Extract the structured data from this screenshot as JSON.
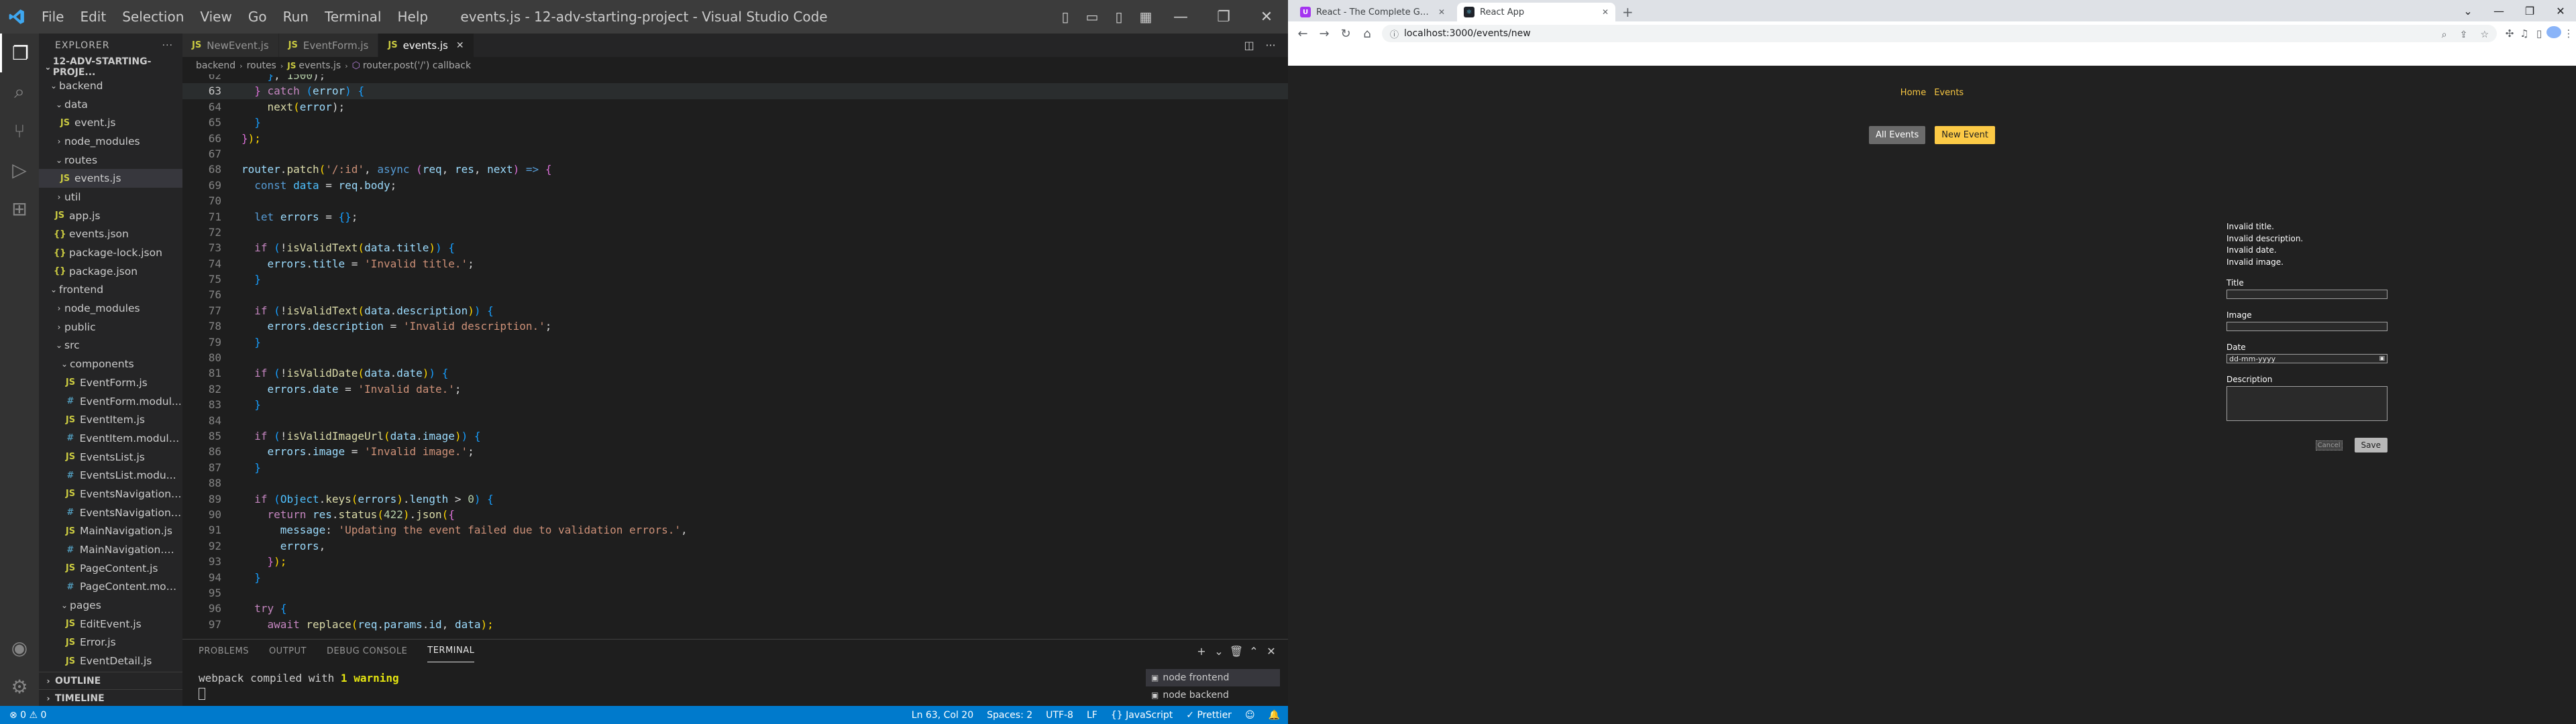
{
  "vscode": {
    "window_title": "events.js - 12-adv-starting-project - Visual Studio Code",
    "menu": [
      "File",
      "Edit",
      "Selection",
      "View",
      "Go",
      "Run",
      "Terminal",
      "Help"
    ],
    "explorer": {
      "header": "EXPLORER",
      "project": "12-ADV-STARTING-PROJE...",
      "tree": [
        {
          "label": "backend",
          "type": "folder",
          "depth": 1,
          "open": true
        },
        {
          "label": "data",
          "type": "folder",
          "depth": 2,
          "open": true
        },
        {
          "label": "event.js",
          "type": "js",
          "depth": 3
        },
        {
          "label": "node_modules",
          "type": "folder",
          "depth": 2,
          "open": false
        },
        {
          "label": "routes",
          "type": "folder",
          "depth": 2,
          "open": true
        },
        {
          "label": "events.js",
          "type": "js",
          "depth": 3,
          "selected": true
        },
        {
          "label": "util",
          "type": "folder",
          "depth": 2,
          "open": false
        },
        {
          "label": "app.js",
          "type": "js",
          "depth": 2
        },
        {
          "label": "events.json",
          "type": "json",
          "depth": 2
        },
        {
          "label": "package-lock.json",
          "type": "json",
          "depth": 2
        },
        {
          "label": "package.json",
          "type": "json",
          "depth": 2
        },
        {
          "label": "frontend",
          "type": "folder",
          "depth": 1,
          "open": true
        },
        {
          "label": "node_modules",
          "type": "folder",
          "depth": 2,
          "open": false
        },
        {
          "label": "public",
          "type": "folder",
          "depth": 2,
          "open": false
        },
        {
          "label": "src",
          "type": "folder",
          "depth": 2,
          "open": true
        },
        {
          "label": "components",
          "type": "folder",
          "depth": 3,
          "open": true
        },
        {
          "label": "EventForm.js",
          "type": "js",
          "depth": 4
        },
        {
          "label": "EventForm.modul...",
          "type": "css",
          "depth": 4
        },
        {
          "label": "EventItem.js",
          "type": "js",
          "depth": 4
        },
        {
          "label": "EventItem.module...",
          "type": "css",
          "depth": 4
        },
        {
          "label": "EventsList.js",
          "type": "js",
          "depth": 4
        },
        {
          "label": "EventsList.modu...",
          "type": "css",
          "depth": 4
        },
        {
          "label": "EventsNavigation.js",
          "type": "js",
          "depth": 4
        },
        {
          "label": "EventsNavigation....",
          "type": "css",
          "depth": 4
        },
        {
          "label": "MainNavigation.js",
          "type": "js",
          "depth": 4
        },
        {
          "label": "MainNavigation.m...",
          "type": "css",
          "depth": 4
        },
        {
          "label": "PageContent.js",
          "type": "js",
          "depth": 4
        },
        {
          "label": "PageContent.mod...",
          "type": "css",
          "depth": 4
        },
        {
          "label": "pages",
          "type": "folder",
          "depth": 3,
          "open": true
        },
        {
          "label": "EditEvent.js",
          "type": "js",
          "depth": 4
        },
        {
          "label": "Error.js",
          "type": "js",
          "depth": 4
        },
        {
          "label": "EventDetail.js",
          "type": "js",
          "depth": 4
        }
      ],
      "outline": "OUTLINE",
      "timeline": "TIMELINE"
    },
    "tabs": [
      {
        "label": "NewEvent.js",
        "active": false
      },
      {
        "label": "EventForm.js",
        "active": false
      },
      {
        "label": "events.js",
        "active": true
      }
    ],
    "breadcrumb": [
      "backend",
      "routes",
      "events.js",
      "router.post('/') callback"
    ],
    "code": {
      "first_line": 62,
      "cursor_line": 63,
      "lines": [
        [
          [
            "    ",
            ""
          ],
          [
            "}",
            "p3"
          ],
          [
            ", ",
            "op"
          ],
          [
            "1500",
            "num"
          ],
          [
            ");",
            "op"
          ]
        ],
        [
          [
            "  ",
            ""
          ],
          [
            "} ",
            "p2"
          ],
          [
            "catch",
            "kw"
          ],
          [
            " ",
            ""
          ],
          [
            "(",
            "p3"
          ],
          [
            "error",
            "var"
          ],
          [
            ")",
            "p3"
          ],
          [
            " ",
            ""
          ],
          [
            "{",
            "p3"
          ]
        ],
        [
          [
            "    ",
            ""
          ],
          [
            "next",
            "fn"
          ],
          [
            "(",
            "p1"
          ],
          [
            "error",
            "var"
          ],
          [
            ");",
            "op"
          ]
        ],
        [
          [
            "  ",
            ""
          ],
          [
            "}",
            "p3"
          ]
        ],
        [
          [
            "}",
            "p2"
          ],
          [
            ");",
            "p1"
          ]
        ],
        [
          [
            "",
            ""
          ]
        ],
        [
          [
            "router",
            "var"
          ],
          [
            ".",
            "op"
          ],
          [
            "patch",
            "fn"
          ],
          [
            "(",
            "p1"
          ],
          [
            "'/:id'",
            "str"
          ],
          [
            ", ",
            "op"
          ],
          [
            "async",
            "dk"
          ],
          [
            " ",
            ""
          ],
          [
            "(",
            "p2"
          ],
          [
            "req",
            "var"
          ],
          [
            ", ",
            "op"
          ],
          [
            "res",
            "var"
          ],
          [
            ", ",
            "op"
          ],
          [
            "next",
            "var"
          ],
          [
            ")",
            "p2"
          ],
          [
            " ",
            ""
          ],
          [
            "=>",
            "dk"
          ],
          [
            " ",
            ""
          ],
          [
            "{",
            "p2"
          ]
        ],
        [
          [
            "  ",
            ""
          ],
          [
            "const",
            "dk"
          ],
          [
            " ",
            ""
          ],
          [
            "data",
            "const"
          ],
          [
            " = ",
            "op"
          ],
          [
            "req",
            "var"
          ],
          [
            ".",
            "op"
          ],
          [
            "body",
            "var"
          ],
          [
            ";",
            "op"
          ]
        ],
        [
          [
            "",
            ""
          ]
        ],
        [
          [
            "  ",
            ""
          ],
          [
            "let",
            "dk"
          ],
          [
            " ",
            ""
          ],
          [
            "errors",
            "var"
          ],
          [
            " = ",
            "op"
          ],
          [
            "{}",
            "p3"
          ],
          [
            ";",
            "op"
          ]
        ],
        [
          [
            "",
            ""
          ]
        ],
        [
          [
            "  ",
            ""
          ],
          [
            "if",
            "kw"
          ],
          [
            " ",
            ""
          ],
          [
            "(",
            "p3"
          ],
          [
            "!",
            "op"
          ],
          [
            "isValidText",
            "fn"
          ],
          [
            "(",
            "p1"
          ],
          [
            "data",
            "var"
          ],
          [
            ".",
            "op"
          ],
          [
            "title",
            "var"
          ],
          [
            ")",
            "p1"
          ],
          [
            ")",
            "p3"
          ],
          [
            " ",
            ""
          ],
          [
            "{",
            "p3"
          ]
        ],
        [
          [
            "    ",
            ""
          ],
          [
            "errors",
            "var"
          ],
          [
            ".",
            "op"
          ],
          [
            "title",
            "var"
          ],
          [
            " = ",
            "op"
          ],
          [
            "'Invalid title.'",
            "str"
          ],
          [
            ";",
            "op"
          ]
        ],
        [
          [
            "  ",
            ""
          ],
          [
            "}",
            "p3"
          ]
        ],
        [
          [
            "",
            ""
          ]
        ],
        [
          [
            "  ",
            ""
          ],
          [
            "if",
            "kw"
          ],
          [
            " ",
            ""
          ],
          [
            "(",
            "p3"
          ],
          [
            "!",
            "op"
          ],
          [
            "isValidText",
            "fn"
          ],
          [
            "(",
            "p1"
          ],
          [
            "data",
            "var"
          ],
          [
            ".",
            "op"
          ],
          [
            "description",
            "var"
          ],
          [
            ")",
            "p1"
          ],
          [
            ")",
            "p3"
          ],
          [
            " ",
            ""
          ],
          [
            "{",
            "p3"
          ]
        ],
        [
          [
            "    ",
            ""
          ],
          [
            "errors",
            "var"
          ],
          [
            ".",
            "op"
          ],
          [
            "description",
            "var"
          ],
          [
            " = ",
            "op"
          ],
          [
            "'Invalid description.'",
            "str"
          ],
          [
            ";",
            "op"
          ]
        ],
        [
          [
            "  ",
            ""
          ],
          [
            "}",
            "p3"
          ]
        ],
        [
          [
            "",
            ""
          ]
        ],
        [
          [
            "  ",
            ""
          ],
          [
            "if",
            "kw"
          ],
          [
            " ",
            ""
          ],
          [
            "(",
            "p3"
          ],
          [
            "!",
            "op"
          ],
          [
            "isValidDate",
            "fn"
          ],
          [
            "(",
            "p1"
          ],
          [
            "data",
            "var"
          ],
          [
            ".",
            "op"
          ],
          [
            "date",
            "var"
          ],
          [
            ")",
            "p1"
          ],
          [
            ")",
            "p3"
          ],
          [
            " ",
            ""
          ],
          [
            "{",
            "p3"
          ]
        ],
        [
          [
            "    ",
            ""
          ],
          [
            "errors",
            "var"
          ],
          [
            ".",
            "op"
          ],
          [
            "date",
            "var"
          ],
          [
            " = ",
            "op"
          ],
          [
            "'Invalid date.'",
            "str"
          ],
          [
            ";",
            "op"
          ]
        ],
        [
          [
            "  ",
            ""
          ],
          [
            "}",
            "p3"
          ]
        ],
        [
          [
            "",
            ""
          ]
        ],
        [
          [
            "  ",
            ""
          ],
          [
            "if",
            "kw"
          ],
          [
            " ",
            ""
          ],
          [
            "(",
            "p3"
          ],
          [
            "!",
            "op"
          ],
          [
            "isValidImageUrl",
            "fn"
          ],
          [
            "(",
            "p1"
          ],
          [
            "data",
            "var"
          ],
          [
            ".",
            "op"
          ],
          [
            "image",
            "var"
          ],
          [
            ")",
            "p1"
          ],
          [
            ")",
            "p3"
          ],
          [
            " ",
            ""
          ],
          [
            "{",
            "p3"
          ]
        ],
        [
          [
            "    ",
            ""
          ],
          [
            "errors",
            "var"
          ],
          [
            ".",
            "op"
          ],
          [
            "image",
            "var"
          ],
          [
            " = ",
            "op"
          ],
          [
            "'Invalid image.'",
            "str"
          ],
          [
            ";",
            "op"
          ]
        ],
        [
          [
            "  ",
            ""
          ],
          [
            "}",
            "p3"
          ]
        ],
        [
          [
            "",
            ""
          ]
        ],
        [
          [
            "  ",
            ""
          ],
          [
            "if",
            "kw"
          ],
          [
            " ",
            ""
          ],
          [
            "(",
            "p3"
          ],
          [
            "Object",
            "const"
          ],
          [
            ".",
            "op"
          ],
          [
            "keys",
            "fn"
          ],
          [
            "(",
            "p1"
          ],
          [
            "errors",
            "var"
          ],
          [
            ")",
            "p1"
          ],
          [
            ".",
            "op"
          ],
          [
            "length",
            "var"
          ],
          [
            " > ",
            "op"
          ],
          [
            "0",
            "num"
          ],
          [
            ")",
            "p3"
          ],
          [
            " ",
            ""
          ],
          [
            "{",
            "p3"
          ]
        ],
        [
          [
            "    ",
            ""
          ],
          [
            "return",
            "kw"
          ],
          [
            " ",
            ""
          ],
          [
            "res",
            "var"
          ],
          [
            ".",
            "op"
          ],
          [
            "status",
            "fn"
          ],
          [
            "(",
            "p1"
          ],
          [
            "422",
            "num"
          ],
          [
            ")",
            "p1"
          ],
          [
            ".",
            "op"
          ],
          [
            "json",
            "fn"
          ],
          [
            "(",
            "p1"
          ],
          [
            "{",
            "p2"
          ]
        ],
        [
          [
            "      ",
            ""
          ],
          [
            "message",
            "var"
          ],
          [
            ": ",
            "op"
          ],
          [
            "'Updating the event failed due to validation errors.'",
            "str"
          ],
          [
            ",",
            "op"
          ]
        ],
        [
          [
            "      ",
            ""
          ],
          [
            "errors",
            "var"
          ],
          [
            ",",
            "op"
          ]
        ],
        [
          [
            "    ",
            ""
          ],
          [
            "}",
            "p2"
          ],
          [
            ");",
            "p1"
          ]
        ],
        [
          [
            "  ",
            ""
          ],
          [
            "}",
            "p3"
          ]
        ],
        [
          [
            "",
            ""
          ]
        ],
        [
          [
            "  ",
            ""
          ],
          [
            "try",
            "kw"
          ],
          [
            " ",
            ""
          ],
          [
            "{",
            "p3"
          ]
        ],
        [
          [
            "    ",
            ""
          ],
          [
            "await",
            "kw"
          ],
          [
            " ",
            ""
          ],
          [
            "replace",
            "fn"
          ],
          [
            "(",
            "p1"
          ],
          [
            "req",
            "var"
          ],
          [
            ".",
            "op"
          ],
          [
            "params",
            "var"
          ],
          [
            ".",
            "op"
          ],
          [
            "id",
            "var"
          ],
          [
            ", ",
            "op"
          ],
          [
            "data",
            "var"
          ],
          [
            ");",
            "p1"
          ]
        ]
      ]
    },
    "panel": {
      "tabs": [
        "PROBLEMS",
        "OUTPUT",
        "DEBUG CONSOLE",
        "TERMINAL"
      ],
      "active_tab": "TERMINAL",
      "terminal_line_prefix": "webpack compiled with ",
      "terminal_line_warn": "1 warning",
      "terminals": [
        "node  frontend",
        "node  backend"
      ]
    },
    "statusbar": {
      "problems": "⊗ 0 ⚠ 0",
      "position": "Ln 63, Col 20",
      "spaces": "Spaces: 2",
      "encoding": "UTF-8",
      "eol": "LF",
      "language": "{} JavaScript",
      "formatter": "✓ Prettier"
    }
  },
  "chrome": {
    "tabs": [
      {
        "title": "React - The Complete Guide (incl...",
        "favicon_color": "#a435f0",
        "active": false
      },
      {
        "title": "React App",
        "favicon_color": "#20232a",
        "active": true
      }
    ],
    "url": "localhost:3000/events/new",
    "page": {
      "nav": [
        "Home",
        "Events"
      ],
      "events_nav": [
        "All Events",
        "New Event"
      ],
      "errors": [
        "Invalid title.",
        "Invalid description.",
        "Invalid date.",
        "Invalid image."
      ],
      "labels": {
        "title": "Title",
        "image": "Image",
        "date": "Date",
        "description": "Description"
      },
      "date_placeholder": "dd-mm-yyyy",
      "cancel": "Cancel",
      "save": "Save"
    }
  }
}
